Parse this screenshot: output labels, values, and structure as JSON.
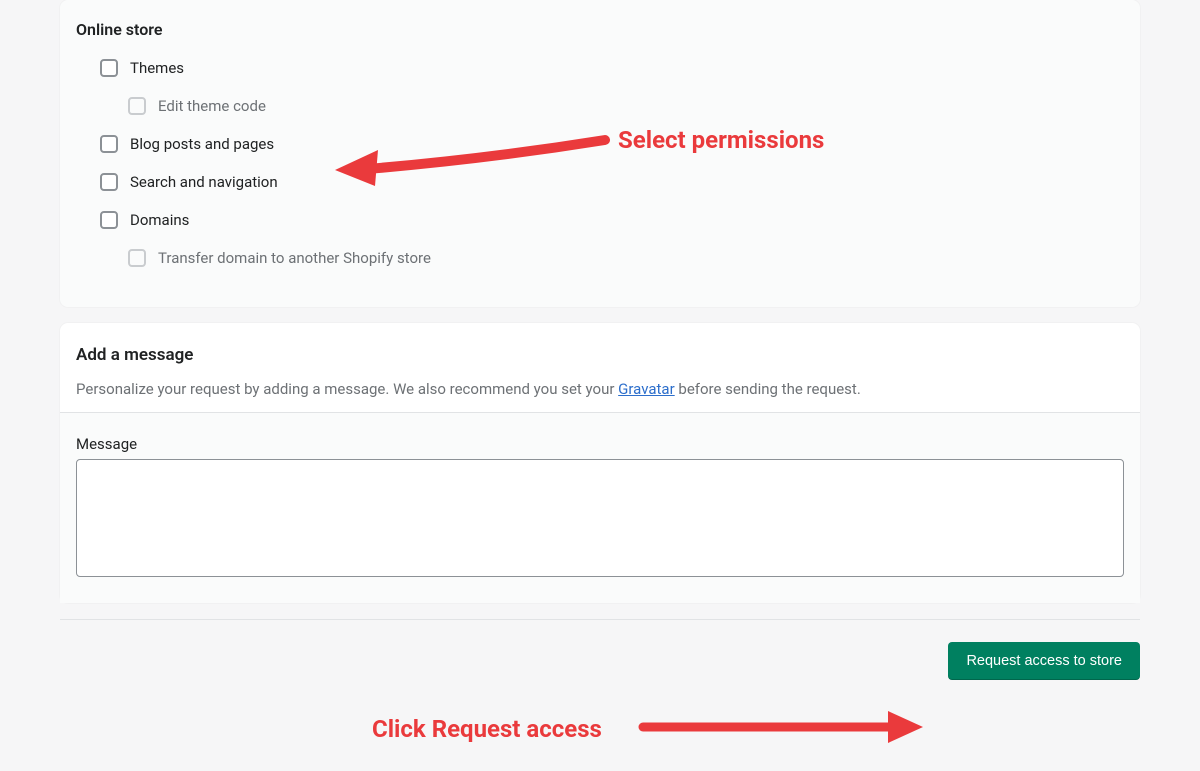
{
  "permissions": {
    "group_title": "Online store",
    "items": [
      {
        "label": "Themes",
        "disabled": false,
        "nested": false
      },
      {
        "label": "Edit theme code",
        "disabled": true,
        "nested": true
      },
      {
        "label": "Blog posts and pages",
        "disabled": false,
        "nested": false
      },
      {
        "label": "Search and navigation",
        "disabled": false,
        "nested": false
      },
      {
        "label": "Domains",
        "disabled": false,
        "nested": false
      },
      {
        "label": "Transfer domain to another Shopify store",
        "disabled": true,
        "nested": true
      }
    ]
  },
  "message_section": {
    "title": "Add a message",
    "description_pre": "Personalize your request by adding a message. We also recommend you set your ",
    "description_link": "Gravatar",
    "description_post": " before sending the request.",
    "field_label": "Message",
    "value": ""
  },
  "footer": {
    "request_button": "Request access to store"
  },
  "annotations": {
    "select_permissions": "Select permissions",
    "click_request": "Click Request access"
  }
}
